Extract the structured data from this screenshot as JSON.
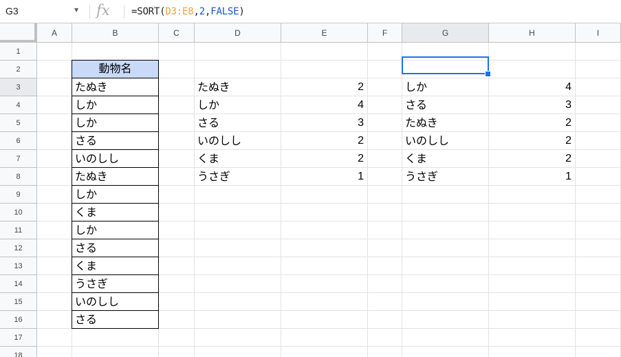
{
  "formula_bar": {
    "name_box": "G3",
    "formula_prefix": "=SORT(",
    "formula_range": "D3:E8",
    "formula_comma1": ",",
    "formula_arg2": "2",
    "formula_comma2": ",",
    "formula_arg3": "FALSE",
    "formula_suffix": ")",
    "fx_label": "fx"
  },
  "colors": {
    "range_ref": "#e8a33b",
    "number_arg": "#1155cc",
    "bool_arg": "#1155cc",
    "header_fill": "#c9daf8",
    "selection": "#1a73e8"
  },
  "columns": [
    "A",
    "B",
    "C",
    "D",
    "E",
    "F",
    "G",
    "H",
    "I"
  ],
  "selected_column": "G",
  "rows": [
    "1",
    "2",
    "3",
    "4",
    "5",
    "6",
    "7",
    "8",
    "9",
    "10",
    "11",
    "12",
    "13",
    "14",
    "15",
    "16",
    "17",
    "18"
  ],
  "selected_row": "3",
  "column_b": {
    "header": "動物名",
    "values": [
      "たぬき",
      "しか",
      "しか",
      "さる",
      "いのしし",
      "たぬき",
      "しか",
      "くま",
      "しか",
      "さる",
      "くま",
      "うさぎ",
      "いのしし",
      "さる"
    ]
  },
  "table_de": [
    {
      "name": "たぬき",
      "count": "2"
    },
    {
      "name": "しか",
      "count": "4"
    },
    {
      "name": "さる",
      "count": "3"
    },
    {
      "name": "いのしし",
      "count": "2"
    },
    {
      "name": "くま",
      "count": "2"
    },
    {
      "name": "うさぎ",
      "count": "1"
    }
  ],
  "table_gh": [
    {
      "name": "しか",
      "count": "4"
    },
    {
      "name": "さる",
      "count": "3"
    },
    {
      "name": "たぬき",
      "count": "2"
    },
    {
      "name": "いのしし",
      "count": "2"
    },
    {
      "name": "くま",
      "count": "2"
    },
    {
      "name": "うさぎ",
      "count": "1"
    }
  ]
}
